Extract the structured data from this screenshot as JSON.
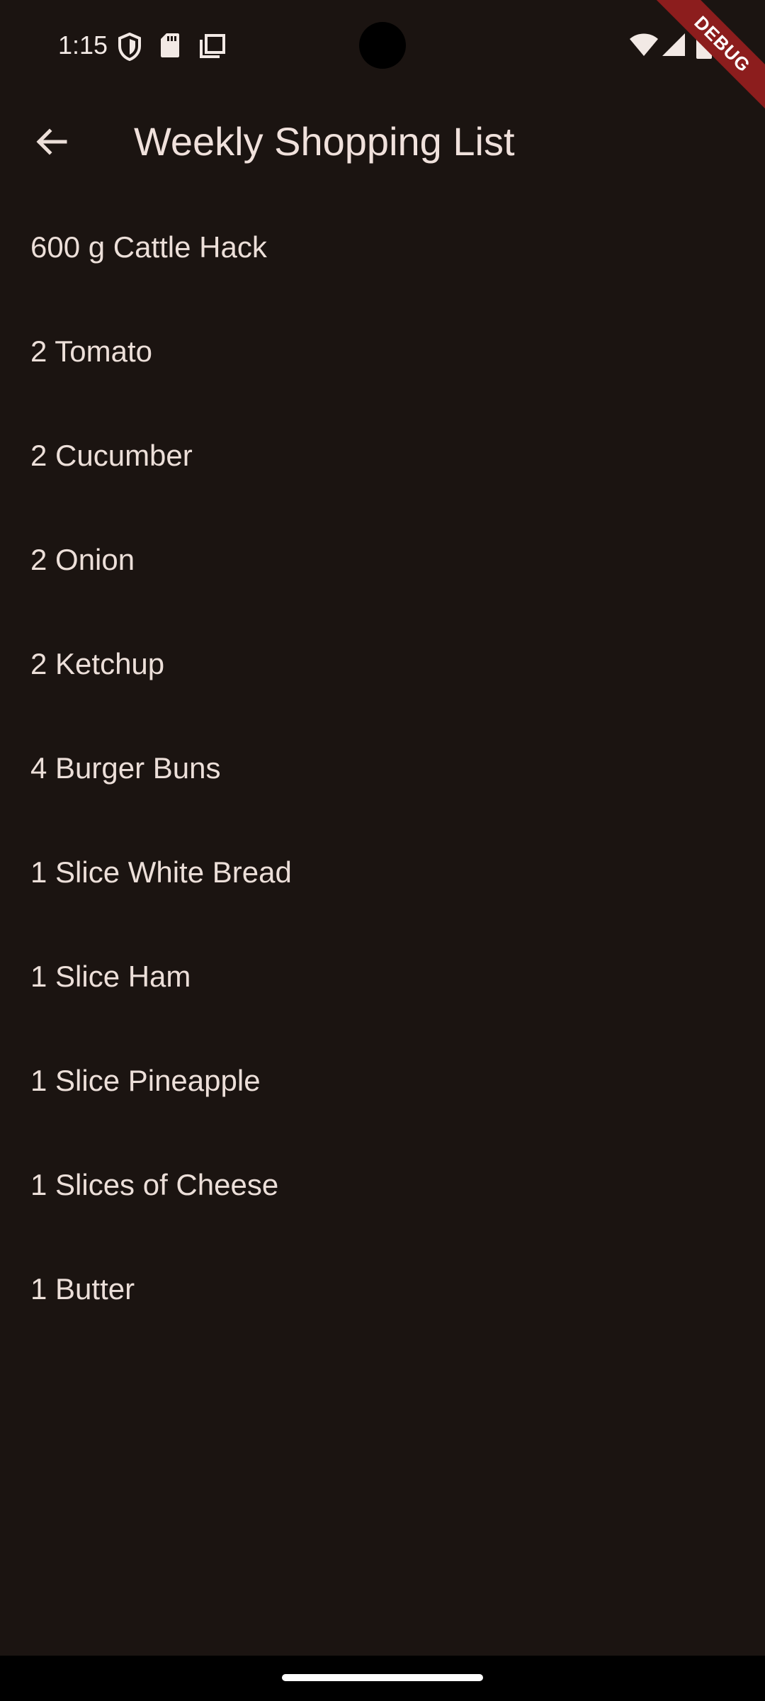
{
  "status_bar": {
    "time": "1:15",
    "icons_left": [
      "shield-icon",
      "sd-card-icon",
      "copy-icon"
    ],
    "icons_right": [
      "wifi-icon",
      "cellular-signal-icon",
      "battery-icon"
    ]
  },
  "debug_banner": {
    "label": "DEBUG",
    "color": "#8c1d1d"
  },
  "app_bar": {
    "back_icon": "arrow-back-icon",
    "title": "Weekly Shopping List"
  },
  "shopping_list": {
    "items": [
      {
        "label": "600 g Cattle Hack"
      },
      {
        "label": "2 Tomato"
      },
      {
        "label": "2 Cucumber"
      },
      {
        "label": "2 Onion"
      },
      {
        "label": "2 Ketchup"
      },
      {
        "label": "4 Burger Buns"
      },
      {
        "label": "1 Slice White Bread"
      },
      {
        "label": "1 Slice Ham"
      },
      {
        "label": "1 Slice Pineapple"
      },
      {
        "label": "1 Slices of Cheese"
      },
      {
        "label": "1 Butter"
      }
    ]
  },
  "colors": {
    "background": "#1b1411",
    "text": "#ecdfd9",
    "title": "#f0e1dc"
  }
}
